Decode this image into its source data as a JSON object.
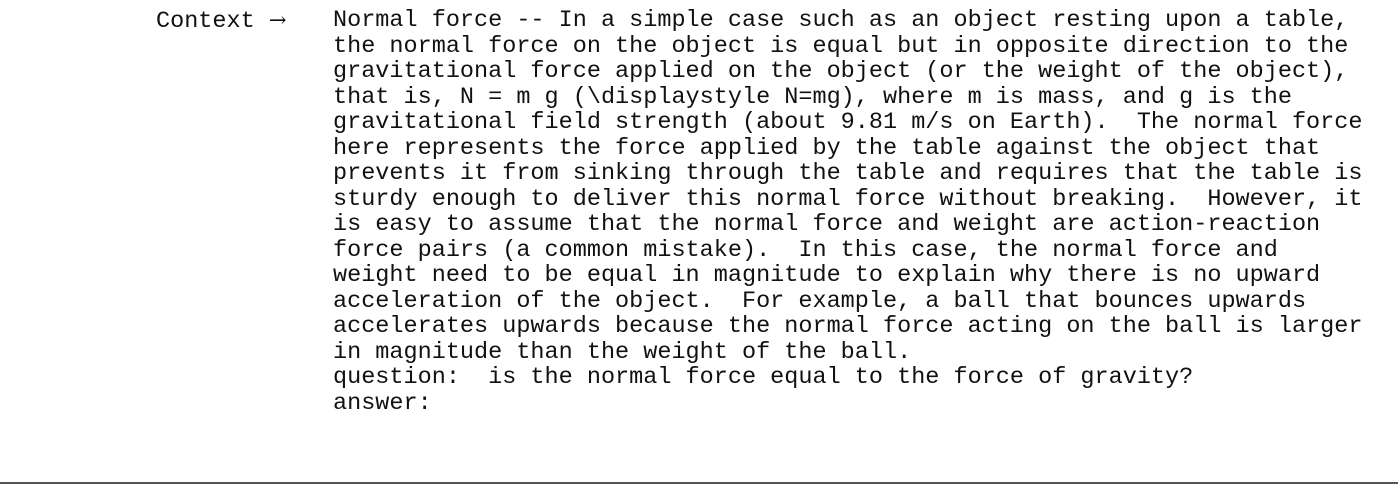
{
  "label": "Context",
  "arrow": "→",
  "context_lines": [
    "Normal force -- In a simple case such as an object resting upon a table,",
    "the normal force on the object is equal but in opposite direction to the",
    "gravitational force applied on the object (or the weight of the object),",
    "that is, N = m g (\\displaystyle N=mg), where m is mass, and g is the",
    "gravitational field strength (about 9.81 m/s on Earth).  The normal force",
    "here represents the force applied by the table against the object that",
    "prevents it from sinking through the table and requires that the table is",
    "sturdy enough to deliver this normal force without breaking.  However, it",
    "is easy to assume that the normal force and weight are action-reaction",
    "force pairs (a common mistake).  In this case, the normal force and",
    "weight need to be equal in magnitude to explain why there is no upward",
    "acceleration of the object.  For example, a ball that bounces upwards",
    "accelerates upwards because the normal force acting on the ball is larger",
    "in magnitude than the weight of the ball."
  ],
  "question": "question:  is the normal force equal to the force of gravity?",
  "answer": "answer:"
}
